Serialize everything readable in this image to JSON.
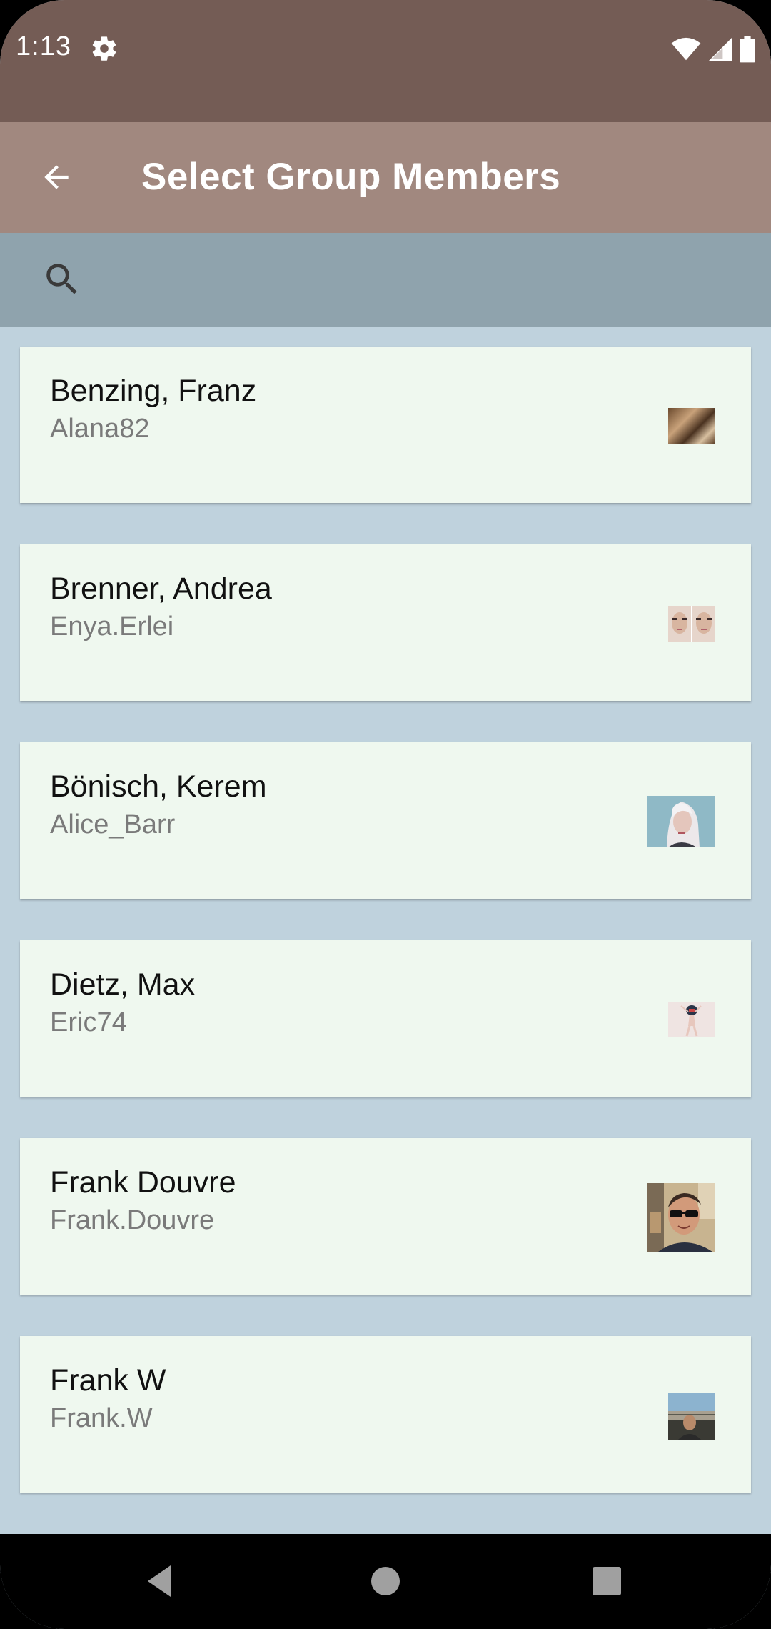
{
  "status_bar": {
    "time": "1:13",
    "icons": [
      "gear-icon",
      "wifi-icon",
      "signal-icon",
      "battery-icon"
    ]
  },
  "app_bar": {
    "title": "Select Group Members",
    "back_icon": "arrow-left-icon"
  },
  "search": {
    "icon": "search-icon",
    "value": ""
  },
  "members": [
    {
      "name": "Benzing, Franz",
      "username": "Alana82",
      "thumb": "food-photo"
    },
    {
      "name": "Brenner, Andrea",
      "username": "Enya.Erlei",
      "thumb": "twin-faces-photo"
    },
    {
      "name": "Bönisch, Kerem",
      "username": "Alice_Barr",
      "thumb": "blonde-portrait-photo"
    },
    {
      "name": "Dietz, Max",
      "username": "Eric74",
      "thumb": "figure-photo"
    },
    {
      "name": "Frank Douvre",
      "username": "Frank.Douvre",
      "thumb": "man-sunglasses-photo"
    },
    {
      "name": "Frank W",
      "username": "Frank.W",
      "thumb": "man-landscape-photo"
    }
  ],
  "nav_bar": {
    "icons": [
      "back-triangle-icon",
      "home-circle-icon",
      "recents-square-icon"
    ]
  },
  "colors": {
    "status_bar": "#745c55",
    "app_bar": "#a1887f",
    "search_bar": "#8fa3ad",
    "list_background": "#bfd2dd",
    "card": "#eff8ef"
  }
}
